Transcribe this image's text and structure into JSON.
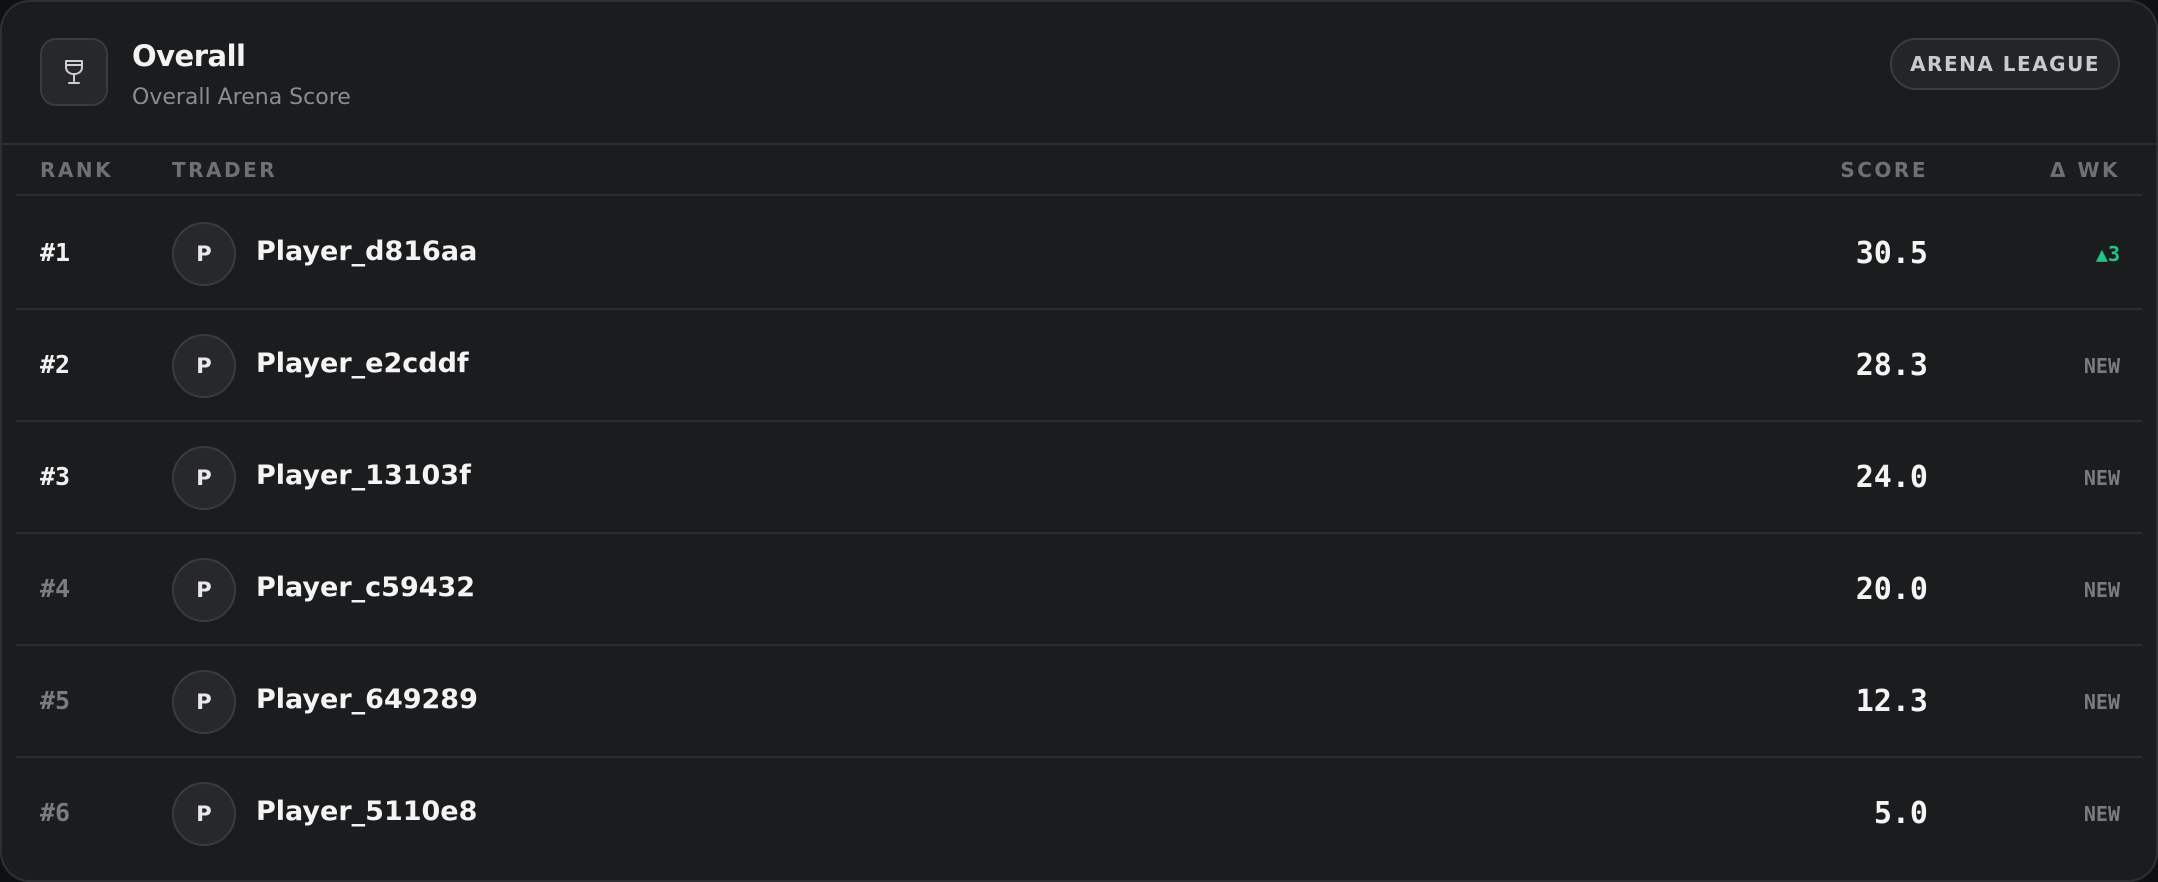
{
  "header": {
    "icon": "trophy-icon",
    "title": "Overall",
    "subtitle": "Overall Arena Score",
    "badge": "ARENA LEAGUE"
  },
  "columns": {
    "rank": "RANK",
    "trader": "TRADER",
    "score": "SCORE",
    "delta": "Δ WK"
  },
  "colors": {
    "background": "#1b1c1e",
    "delta_up": "#22c585",
    "muted": "#7b7c80"
  },
  "rows": [
    {
      "rank": "#1",
      "avatar": "P",
      "name": "Player_d816aa",
      "score": "30.5",
      "delta": "▲3",
      "delta_type": "up"
    },
    {
      "rank": "#2",
      "avatar": "P",
      "name": "Player_e2cddf",
      "score": "28.3",
      "delta": "NEW",
      "delta_type": "new"
    },
    {
      "rank": "#3",
      "avatar": "P",
      "name": "Player_13103f",
      "score": "24.0",
      "delta": "NEW",
      "delta_type": "new"
    },
    {
      "rank": "#4",
      "avatar": "P",
      "name": "Player_c59432",
      "score": "20.0",
      "delta": "NEW",
      "delta_type": "new"
    },
    {
      "rank": "#5",
      "avatar": "P",
      "name": "Player_649289",
      "score": "12.3",
      "delta": "NEW",
      "delta_type": "new"
    },
    {
      "rank": "#6",
      "avatar": "P",
      "name": "Player_5110e8",
      "score": "5.0",
      "delta": "NEW",
      "delta_type": "new"
    }
  ]
}
